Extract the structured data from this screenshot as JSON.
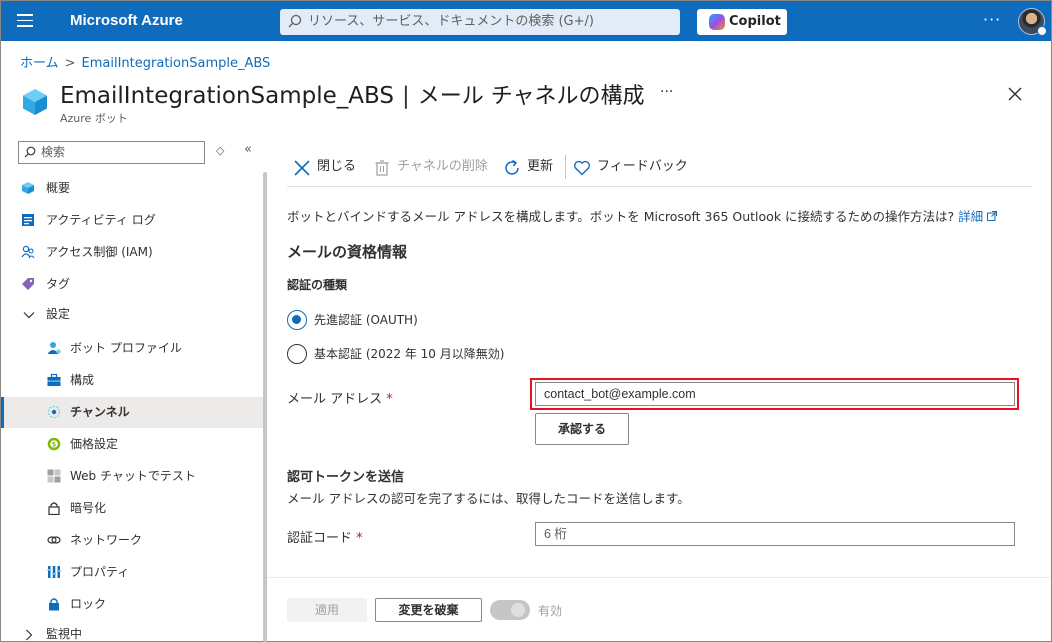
{
  "topbar": {
    "brand": "Microsoft Azure",
    "search_placeholder": "リソース、サービス、ドキュメントの検索 (G+/)",
    "copilot_label": "Copilot",
    "more_label": "···",
    "accent": "#0f6cbd"
  },
  "breadcrumb": {
    "home": "ホーム",
    "sep": ">",
    "current": "EmailIntegrationSample_ABS"
  },
  "header": {
    "resource_name": "EmailIntegrationSample_ABS",
    "separator": "|",
    "blade_title": "メール チャネルの構成",
    "more": "···",
    "subtitle": "Azure ボット"
  },
  "nav": {
    "search_placeholder": "検索",
    "sort_icon": "◇",
    "collapse_icon": "«",
    "items": [
      {
        "label": "概要",
        "icon": "cube-icon"
      },
      {
        "label": "アクティビティ ログ",
        "icon": "activity-log-icon"
      },
      {
        "label": "アクセス制御 (IAM)",
        "icon": "people-icon"
      },
      {
        "label": "タグ",
        "icon": "tag-icon"
      },
      {
        "label": "設定",
        "icon": "chevron-down-icon"
      },
      {
        "label": "ボット プロファイル",
        "icon": "bot-profile-icon"
      },
      {
        "label": "構成",
        "icon": "toolbox-icon"
      },
      {
        "label": "チャンネル",
        "icon": "channels-icon"
      },
      {
        "label": "価格設定",
        "icon": "pricing-icon"
      },
      {
        "label": "Web チャットでテスト",
        "icon": "webchat-icon"
      },
      {
        "label": "暗号化",
        "icon": "lock-icon"
      },
      {
        "label": "ネットワーク",
        "icon": "network-icon"
      },
      {
        "label": "プロパティ",
        "icon": "properties-icon"
      },
      {
        "label": "ロック",
        "icon": "lock-icon"
      },
      {
        "label": "監視中",
        "icon": "chevron-right-icon"
      }
    ]
  },
  "commands": {
    "close": "閉じる",
    "delete": "チャネルの削除",
    "refresh": "更新",
    "feedback": "フィードバック"
  },
  "content": {
    "description": "ボットとバインドするメール アドレスを構成します。ボットを Microsoft 365 Outlook に接続するための操作方法は?",
    "learn_more": "詳細",
    "section_title": "メールの資格情報",
    "auth_type_label": "認証の種類",
    "radio_oauth": "先進認証 (OAUTH)",
    "radio_basic": "基本認証 (2022 年 10 月以降無効)",
    "email_label": "メール アドレス",
    "required_mark": "*",
    "email_value": "contact_bot@example.com",
    "approve_button": "承認する",
    "token_title": "認可トークンを送信",
    "token_desc": "メール アドレスの認可を完了するには、取得したコードを送信します。",
    "code_label": "認証コード",
    "code_placeholder": "6 桁"
  },
  "footer": {
    "apply": "適用",
    "discard": "変更を破棄",
    "enabled_label": "有効",
    "enabled": false
  }
}
